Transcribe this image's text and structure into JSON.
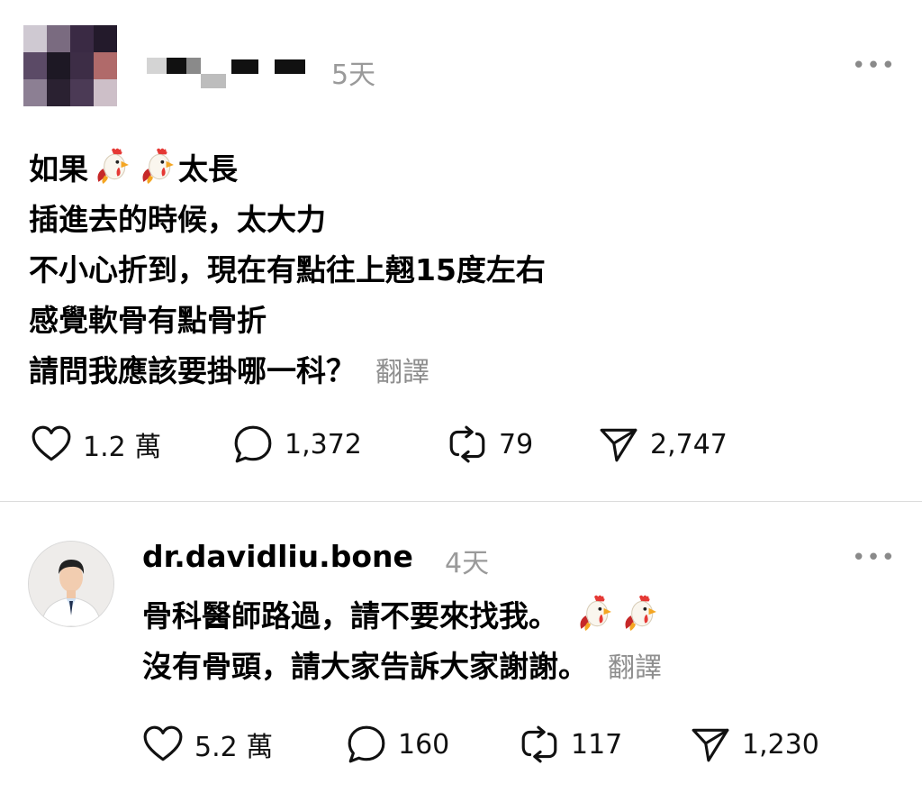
{
  "post1": {
    "username_redacted": true,
    "time": "5天",
    "more": "•••",
    "text": {
      "line1_before": "如果",
      "line1_after": "太長",
      "line2": "插進去的時候，太大力",
      "line3": "不小心折到，現在有點往上翹15度左右",
      "line4": "感覺軟骨有點骨折",
      "line5": "請問我應該要掛哪一科？"
    },
    "translate": "翻譯",
    "emoji": [
      "rooster-emoji",
      "rooster-emoji"
    ],
    "stats": {
      "likes": "1.2 萬",
      "comments": "1,372",
      "reposts": "79",
      "shares": "2,747"
    }
  },
  "post2": {
    "username": "dr.davidliu.bone",
    "time": "4天",
    "more": "•••",
    "text": {
      "line1": "骨科醫師路過，請不要來找我。",
      "line2": "沒有骨頭，請大家告訴大家謝謝。"
    },
    "translate": "翻譯",
    "emoji": [
      "rooster-emoji",
      "rooster-emoji"
    ],
    "stats": {
      "likes": "5.2 萬",
      "comments": "160",
      "reposts": "117",
      "shares": "1,230"
    }
  },
  "icons": {
    "like": "heart-icon",
    "comment": "comment-bubble-icon",
    "repost": "repost-icon",
    "share": "send-icon"
  },
  "colors": {
    "text": "#000000",
    "muted": "#9a9a9a",
    "divider": "#dcdcdc"
  }
}
